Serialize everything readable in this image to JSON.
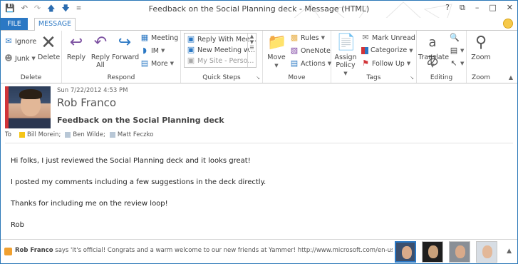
{
  "window": {
    "title": "Feedback on the Social Planning deck - Message (HTML)",
    "qat": [
      "save-icon",
      "undo-icon",
      "redo-icon",
      "up-icon",
      "down-icon",
      "more-icon"
    ],
    "controls": {
      "help": "?",
      "restore": "⧉",
      "minimize": "–",
      "maximize": "□",
      "close": "✕"
    }
  },
  "tabs": {
    "file": "FILE",
    "message": "MESSAGE"
  },
  "ribbon": {
    "delete": {
      "ignore": "Ignore",
      "junk": "Junk",
      "delete": "Delete",
      "label": "Delete"
    },
    "respond": {
      "reply": "Reply",
      "reply_all_1": "Reply",
      "reply_all_2": "All",
      "forward": "Forward",
      "meeting": "Meeting",
      "im": "IM",
      "more": "More",
      "label": "Respond"
    },
    "quick_steps": {
      "items": [
        "Reply With Mee...",
        "New Meeting w...",
        "My Site - Perso..."
      ],
      "label": "Quick Steps"
    },
    "move": {
      "move": "Move",
      "rules": "Rules",
      "onenote": "OneNote",
      "actions": "Actions",
      "label": "Move"
    },
    "tags": {
      "assign_1": "Assign",
      "assign_2": "Policy",
      "mark_unread": "Mark Unread",
      "categorize": "Categorize",
      "follow_up": "Follow Up",
      "label": "Tags"
    },
    "editing": {
      "translate": "Translate",
      "label": "Editing"
    },
    "zoom": {
      "zoom": "Zoom",
      "label": "Zoom"
    }
  },
  "message": {
    "date": "Sun 7/22/2012 4:53 PM",
    "sender": "Rob Franco",
    "subject": "Feedback on the Social Planning deck",
    "to_label": "To",
    "recipients": [
      {
        "name": "Bill Morein;",
        "color": "#f5c518"
      },
      {
        "name": "Ben Wilde;",
        "color": "#b8c7d6"
      },
      {
        "name": "Matt Feczko",
        "color": "#b8c7d6"
      }
    ],
    "body": [
      "Hi folks, I just reviewed the Social Planning deck and it looks great!",
      "I posted my comments including a few suggestions in the deck directly.",
      "Thanks for including me on the review loop!",
      "Rob"
    ]
  },
  "people_pane": {
    "name": "Rob Franco",
    "text": " says 'It's official! Congrats and a warm welcome to our new friends at Yammer! http://www.microsoft.com/en-us/news...",
    "expand": "▲"
  },
  "colors": {
    "accent": "#2b78c4",
    "presence_busy": "#d13438"
  }
}
